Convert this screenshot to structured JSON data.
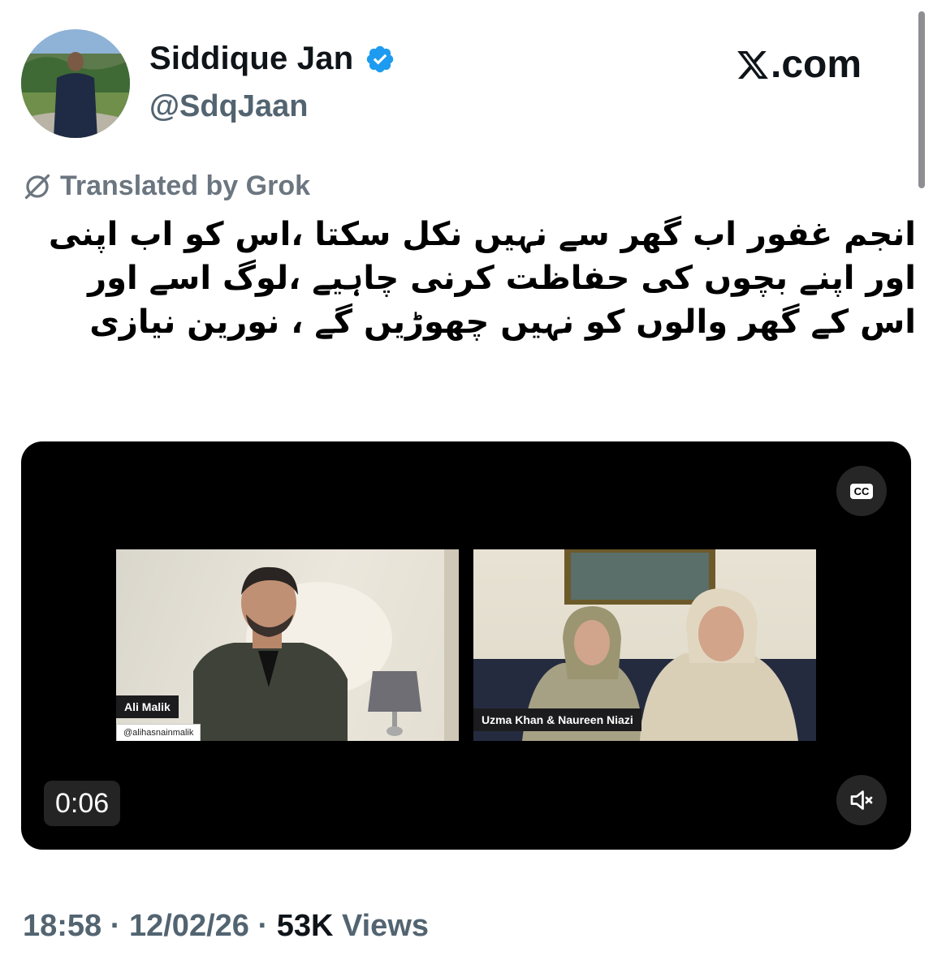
{
  "author": {
    "display_name": "Siddique Jan",
    "handle": "@SdqJaan",
    "verified": true,
    "verified_color": "#1d9bf0"
  },
  "brand": {
    "label": ".com",
    "logo_icon": "x-logo-icon"
  },
  "translation": {
    "label": "Translated by Grok",
    "icon": "grok-icon"
  },
  "tweet": {
    "text": "انجم غفور اب گھر سے نہیں نکل سکتا ،اس کو اب اپنی اور اپنے بچوں کی حفاظت کرنی چاہیے ،لوگ اسے اور اس کے گھر والوں کو نہیں چھوڑیں گے ، نورین نیازی"
  },
  "video": {
    "timestamp": "0:06",
    "left_speaker": {
      "name": "Ali Malik",
      "handle": "@alihasnainmalik"
    },
    "right_speaker": {
      "name": "Uzma Khan & Naureen Niazi"
    },
    "cc_label": "CC",
    "mute_icon": "speaker-muted-icon"
  },
  "meta": {
    "time": "18:58",
    "date": "12/02/26",
    "views_count": "53K",
    "views_label": "Views",
    "separator": "·"
  }
}
